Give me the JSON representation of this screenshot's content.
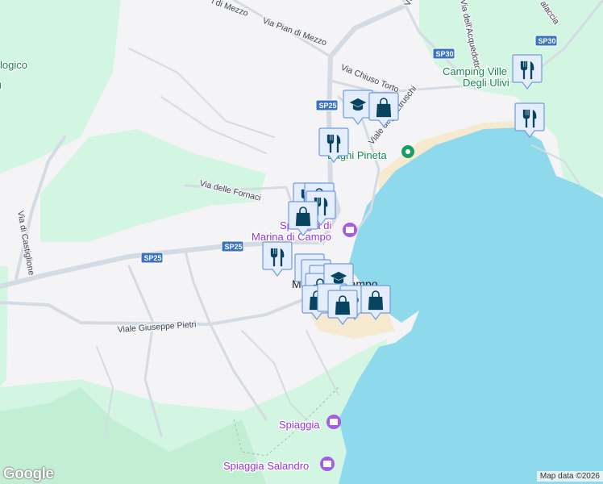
{
  "map": {
    "colors": {
      "land": "#f4f3f5",
      "park": "#d3f6e2",
      "forest": "#c2eed4",
      "water": "#8fd9ec",
      "sand": "#f5ead0",
      "road": "#d5dbe3",
      "marker_fill": "#e4edfc",
      "marker_border": "#6f9be0",
      "marker_icon": "#08445f"
    },
    "roads": {
      "pian_di_mezzo_1": "Via Pian di Mezzo",
      "pian_di_mezzo_2": "Via Pian di Mezzo",
      "chiuso_torto": "Via Chiuso Torto",
      "etruschi": "Viale degli Etruschi",
      "fornaci": "Via delle Fornaci",
      "castiglione": "Via di Castiglione",
      "pietri": "Viale Giuseppe Pietri",
      "acquedotto": "Via dell'Acquedotto",
      "top_partial_1": "Vi",
      "top_partial_2": "alaccia"
    },
    "shields": [
      "SP25",
      "SP25",
      "SP25",
      "SP30",
      "SP30"
    ],
    "places": {
      "camping_line1": "Camping Ville",
      "camping_line2": "Degli Ulivi",
      "bagni_pineta": "Bagni Pineta",
      "spiaggia_marina_line1": "Spiaggia di",
      "spiaggia_marina_line2": "Marina di Campo",
      "spiaggia": "Spiaggia",
      "spiaggia_salandro": "Spiaggia Salandro",
      "town": "Marina di Campo",
      "left_partial": "logico",
      "left_partial_2": "d"
    },
    "markers": [
      "restaurant",
      "restaurant",
      "school",
      "shopping",
      "restaurant",
      "restaurant",
      "shopping",
      "restaurant",
      "shopping",
      "restaurant",
      "generic",
      "generic",
      "generic",
      "shopping",
      "school",
      "shopping",
      "generic",
      "generic",
      "shopping",
      "shopping"
    ]
  },
  "footer": {
    "logo": "Google",
    "attribution": "Map data ©2026"
  }
}
